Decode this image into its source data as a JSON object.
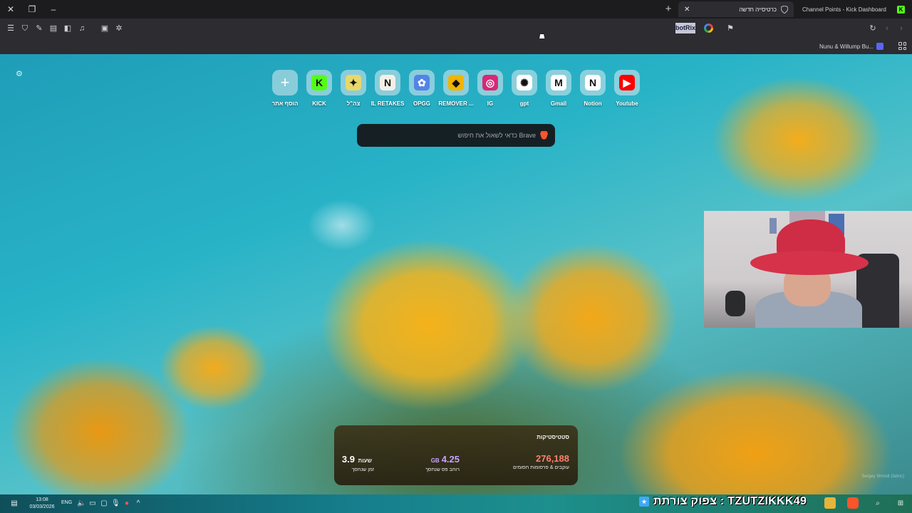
{
  "tabs": [
    {
      "title": "כרטיסייה חדשה",
      "active": true
    },
    {
      "title": "Channel Points - Kick Dashboard",
      "active": false
    }
  ],
  "toolbar": {
    "extension_label": "botRix"
  },
  "bookmarks": {
    "items": [
      {
        "label": "Nunu & Willump Bu..."
      }
    ]
  },
  "tiles": [
    {
      "label": "Youtube",
      "icon": "youtube-icon",
      "glyph": "▶",
      "bg": "#ff0000"
    },
    {
      "label": "Notion",
      "icon": "notion-icon",
      "glyph": "N",
      "bg": "#ffffff"
    },
    {
      "label": "Gmail",
      "icon": "gmail-icon",
      "glyph": "M",
      "bg": "#ffffff"
    },
    {
      "label": "gpt",
      "icon": "chatgpt-icon",
      "glyph": "✺",
      "bg": "#ffffff"
    },
    {
      "label": "IG",
      "icon": "instagram-icon",
      "glyph": "◎",
      "bg": "#d62976"
    },
    {
      "label": "REMOVER ...",
      "icon": "remover-icon",
      "glyph": "◆",
      "bg": "#f2b400"
    },
    {
      "label": "OPGG",
      "icon": "opgg-icon",
      "glyph": "✿",
      "bg": "#5383e8"
    },
    {
      "label": "IL RETAKES",
      "icon": "il-retakes-icon",
      "glyph": "N",
      "bg": "#f3f0e8"
    },
    {
      "label": "צה\"ל",
      "icon": "idf-icon",
      "glyph": "✦",
      "bg": "#e8d86a"
    },
    {
      "label": "KICK",
      "icon": "kick-icon",
      "glyph": "K",
      "bg": "#53fc18"
    },
    {
      "label": "הוסף אתר",
      "icon": "plus-icon",
      "glyph": "+",
      "bg": "transparent"
    }
  ],
  "search": {
    "placeholder": "כדאי לשאול את חיפוש Brave"
  },
  "stats": {
    "title": "סטטיסטיקות",
    "trackers": {
      "value": "276,188",
      "label": "עוקבים & פרסומות חסומים",
      "color": "#ff7f6b"
    },
    "bandwidth": {
      "value": "4.25",
      "unit": "GB",
      "label": "רוחב פס שנחסך",
      "color": "#c9a2ff"
    },
    "time": {
      "value": "3.9",
      "unit": "שעות",
      "label": "זמן שנחסך",
      "color": "#ffffff"
    }
  },
  "credit": "Sergey Shmidt (fabric)",
  "taskbar": {
    "time": "13:08",
    "date": "03/03/2026",
    "lang": "ENG",
    "ticker": "צפוק צורתת : TZUTZIKKK49"
  }
}
